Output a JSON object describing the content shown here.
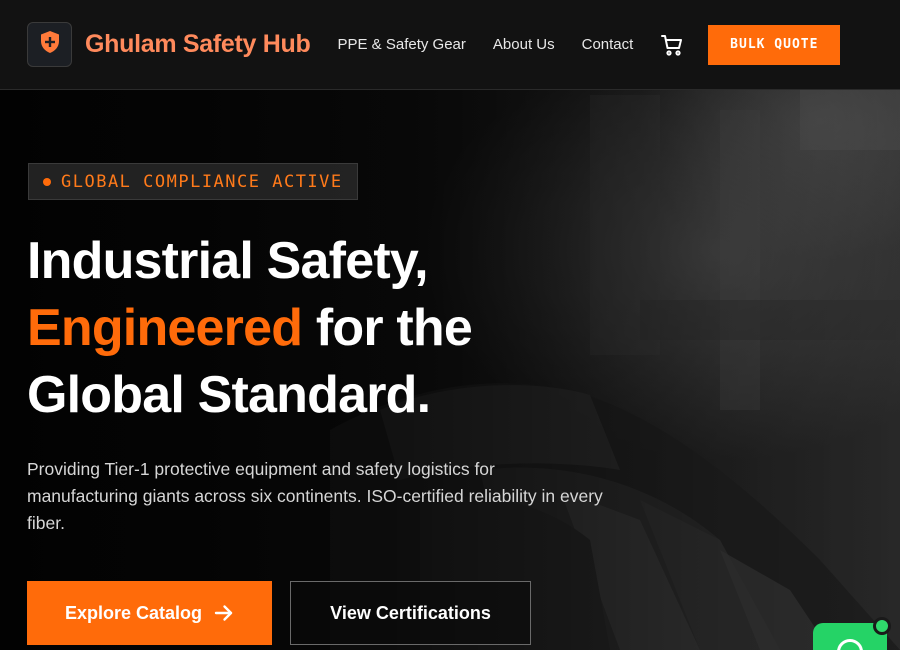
{
  "header": {
    "brand": "Ghulam Safety Hub",
    "logo_icon": "shield-plus-icon",
    "nav": [
      {
        "label": "PPE & Safety Gear"
      },
      {
        "label": "About Us"
      },
      {
        "label": "Contact"
      }
    ],
    "cart_icon": "shopping-cart-icon",
    "cta_label": "BULK QUOTE"
  },
  "hero": {
    "badge": "GLOBAL COMPLIANCE ACTIVE",
    "headline_line1": "Industrial Safety,",
    "headline_accent": "Engineered",
    "headline_line2_rest": " for the",
    "headline_line3": "Global Standard.",
    "subcopy": "Providing Tier-1 protective equipment and safety logistics for manufacturing giants across six continents. ISO-certified reliability in every fiber.",
    "primary_button": "Explore Catalog",
    "secondary_button": "View Certifications"
  },
  "colors": {
    "accent": "#ff6b0a",
    "brand_text": "#ff8a5c",
    "chat_green": "#25d366"
  }
}
